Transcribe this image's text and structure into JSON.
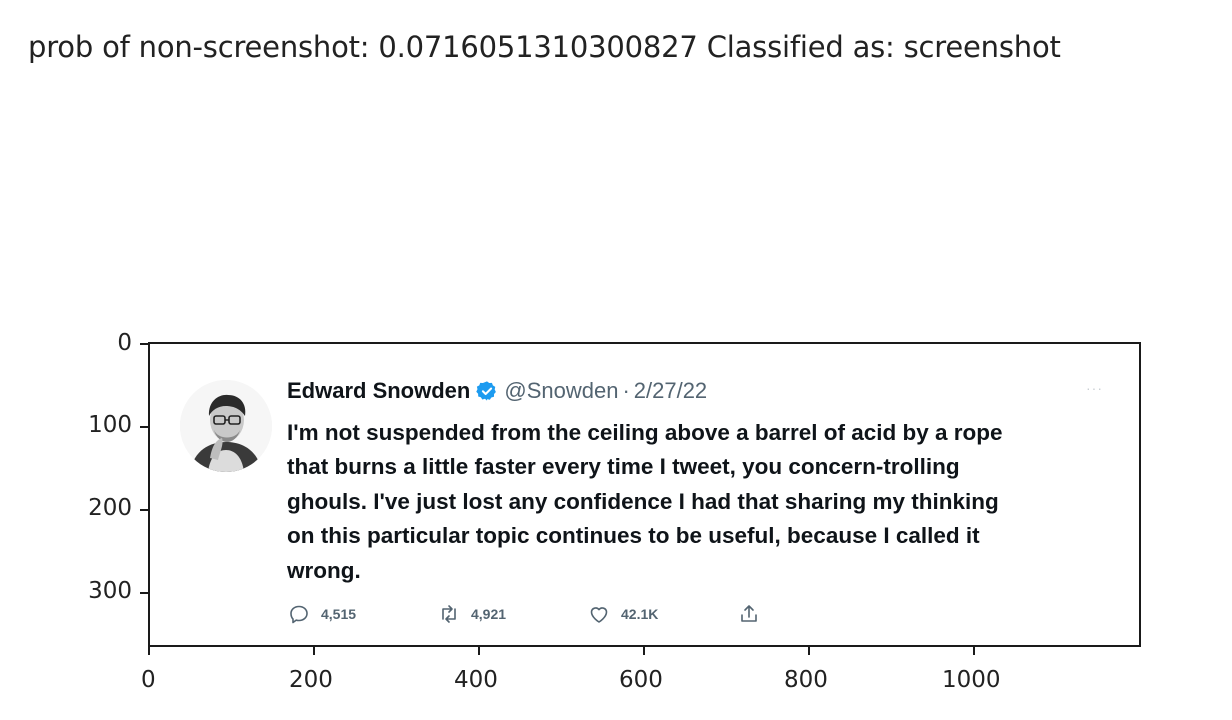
{
  "header": {
    "title": "prob of non-screenshot: 0.0716051310300827 Classified as: screenshot"
  },
  "axes": {
    "x_ticks": [
      "0",
      "200",
      "400",
      "600",
      "800",
      "1000"
    ],
    "y_ticks": [
      "0",
      "100",
      "200",
      "300"
    ]
  },
  "tweet": {
    "author_name": "Edward Snowden",
    "handle": "@Snowden",
    "separator": "·",
    "date": "2/27/22",
    "more": "···",
    "text_lines": [
      "I'm not suspended from the ceiling above a barrel of acid by a rope",
      "that burns a little faster every time I tweet, you concern-trolling",
      "ghouls. I've just lost any confidence I had that sharing my thinking",
      "on this particular topic continues to be useful, because I called it",
      "wrong."
    ],
    "actions": {
      "reply_count": "4,515",
      "retweet_count": "4,921",
      "like_count": "42.1K"
    },
    "icons": {
      "reply": "reply-icon",
      "retweet": "retweet-icon",
      "like": "like-icon",
      "share": "share-icon",
      "verified": "verified-badge-icon",
      "more": "more-icon"
    }
  },
  "colors": {
    "text_primary": "#0f1419",
    "text_secondary": "#536471",
    "verified_blue": "#1d9bf0",
    "axis": "#1a1a1a"
  }
}
